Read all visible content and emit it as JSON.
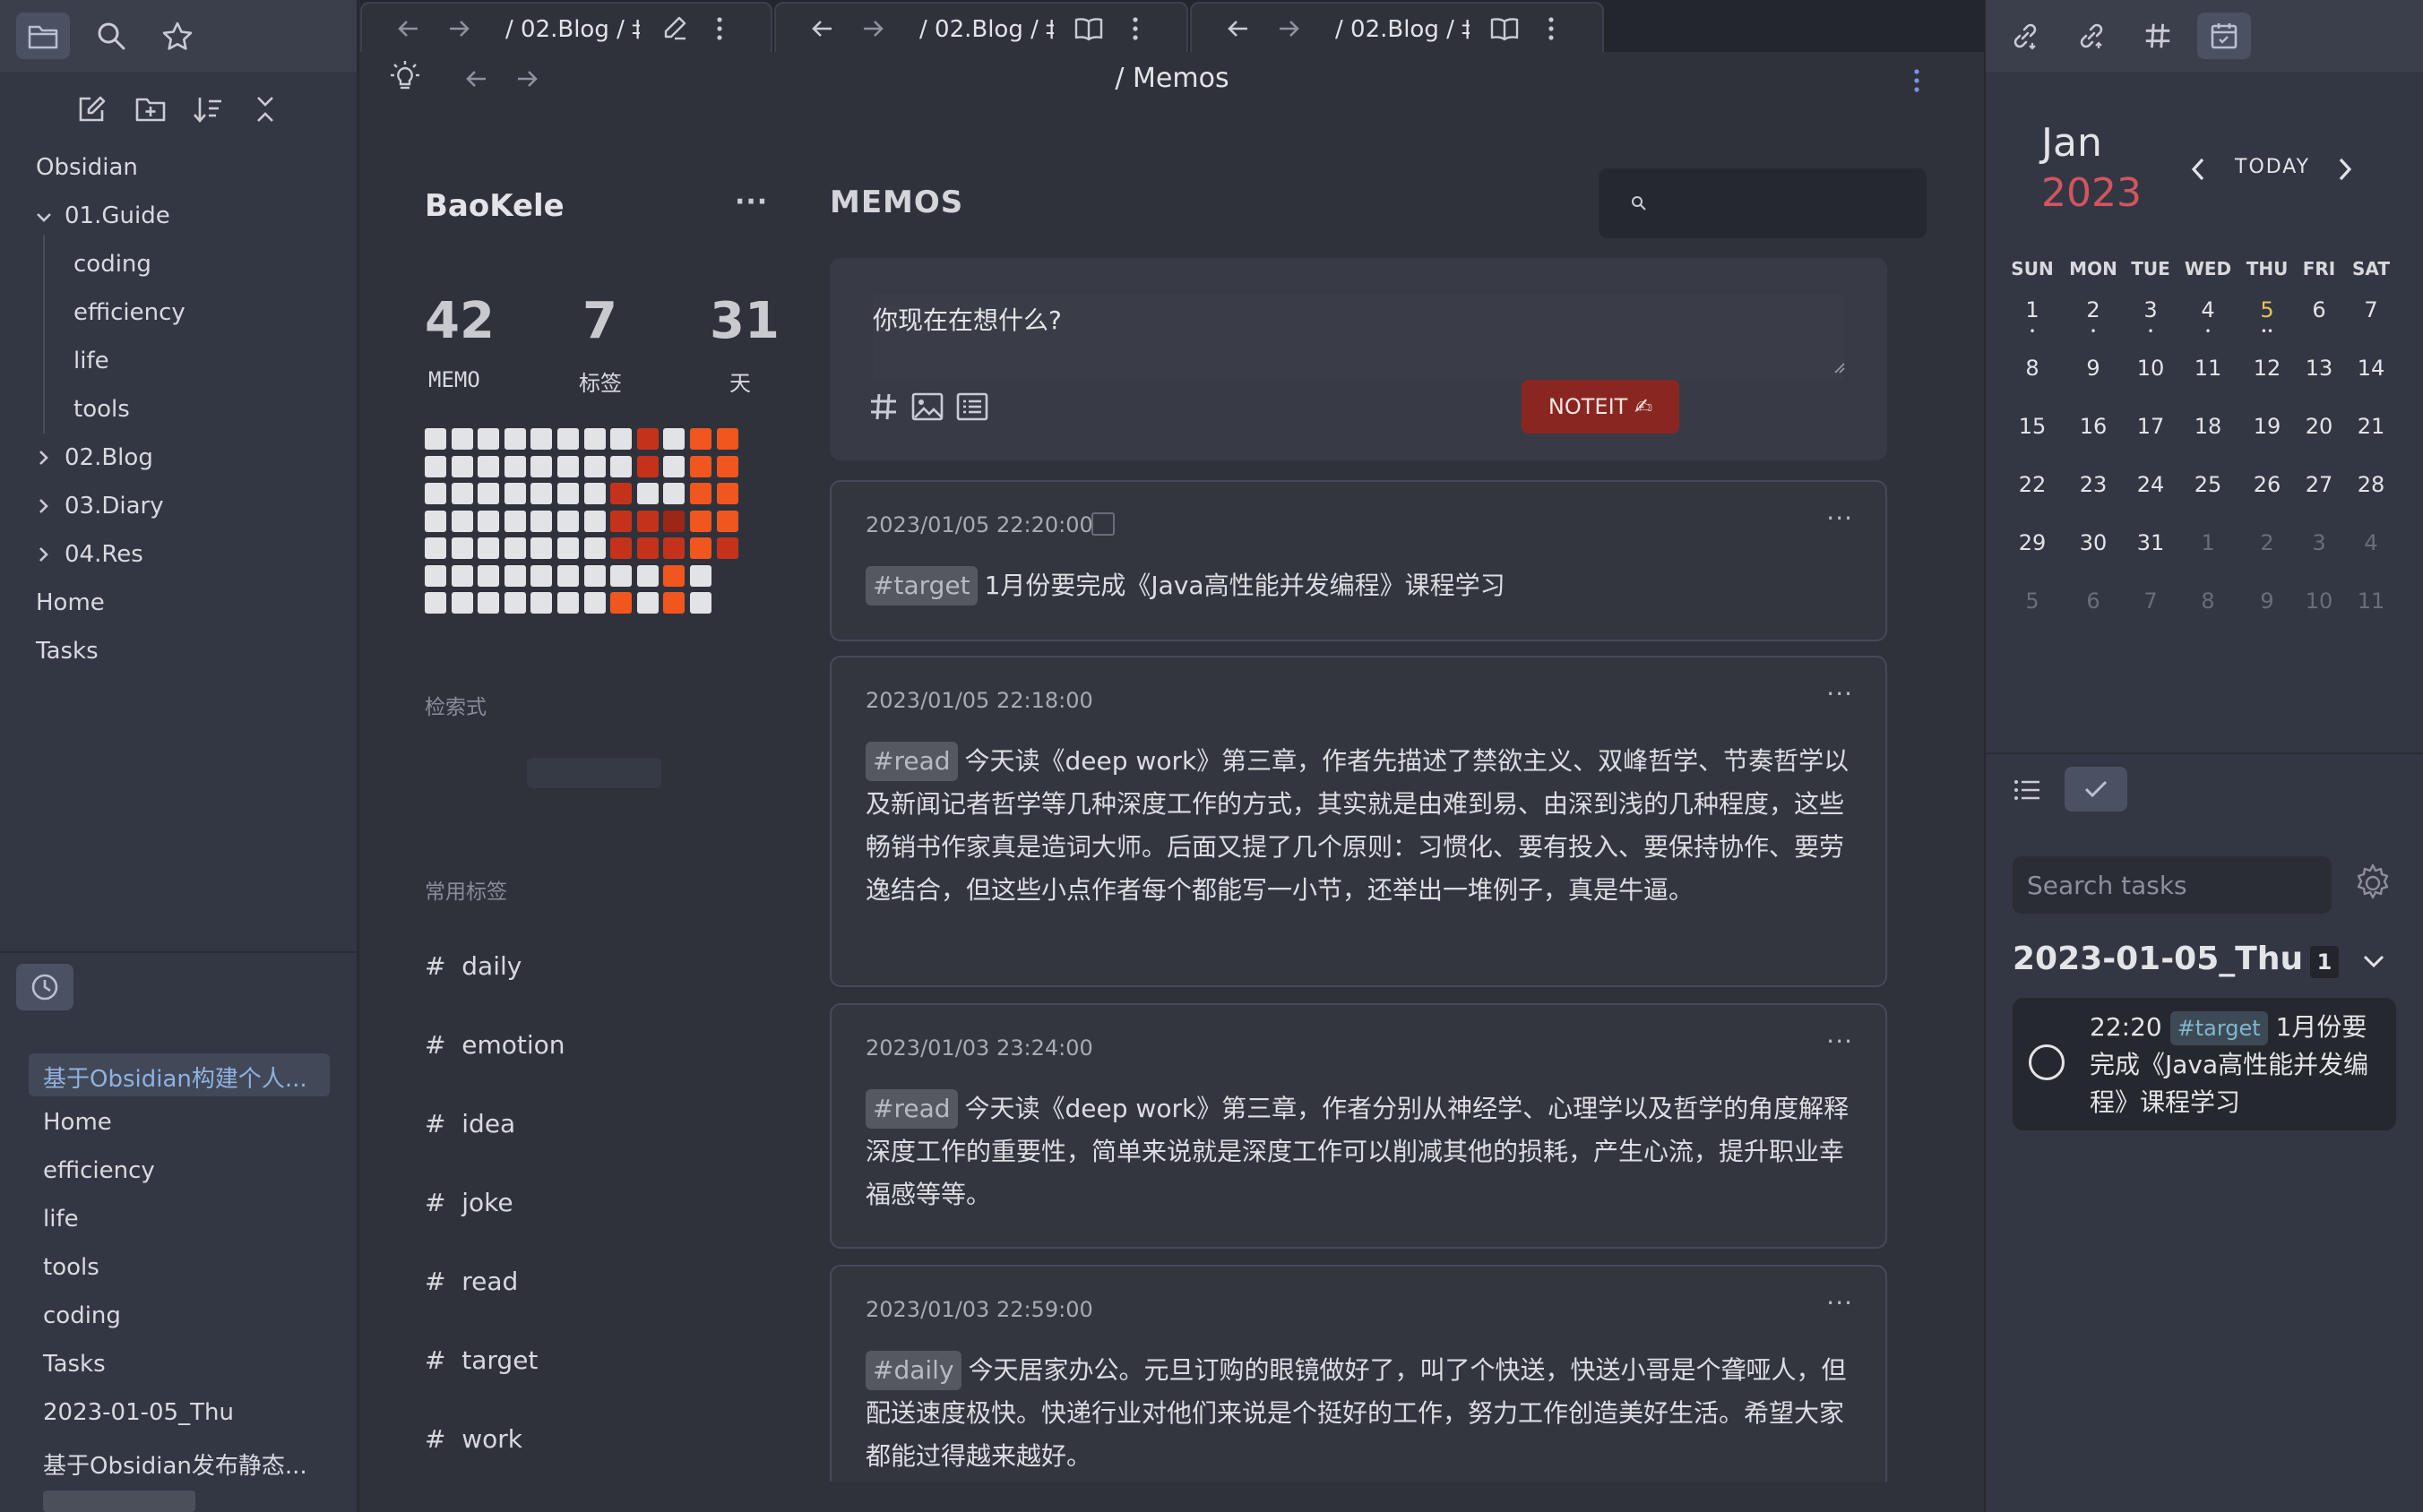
{
  "left_sidebar": {
    "vault_name": "Obsidian",
    "tree": [
      {
        "label": "01.Guide",
        "expanded": true
      },
      {
        "label": "coding"
      },
      {
        "label": "efficiency"
      },
      {
        "label": "life"
      },
      {
        "label": "tools"
      },
      {
        "label": "02.Blog",
        "expanded": false
      },
      {
        "label": "03.Diary",
        "expanded": false
      },
      {
        "label": "04.Res",
        "expanded": false
      },
      {
        "label": "Home"
      },
      {
        "label": "Tasks"
      }
    ],
    "recent": [
      "基于Obsidian构建个人...",
      "Home",
      "efficiency",
      "life",
      "tools",
      "coding",
      "Tasks",
      "2023-01-05_Thu",
      "基于Obsidian发布静态..."
    ]
  },
  "tabs": [
    {
      "crumb": "/ 02.Blog / ‡",
      "mode_icon": "pencil-icon"
    },
    {
      "crumb": "/ 02.Blog / ‡",
      "mode_icon": "book-open-icon"
    },
    {
      "crumb": "/ 02.Blog / ‡",
      "mode_icon": "book-open-icon"
    }
  ],
  "view": {
    "title": "/ Memos"
  },
  "memos": {
    "user_name": "BaoKele",
    "profile_more": "···",
    "stats": [
      {
        "value": "42",
        "label": "MEMO"
      },
      {
        "value": "7",
        "label": "标签"
      },
      {
        "value": "31",
        "label": "天"
      }
    ],
    "heatmap": [
      [
        "e",
        "e",
        "e",
        "e",
        "e",
        "e",
        "e",
        "e",
        "r",
        "e",
        "o",
        "o"
      ],
      [
        "e",
        "e",
        "e",
        "e",
        "e",
        "e",
        "e",
        "e",
        "r",
        "e",
        "o",
        "o"
      ],
      [
        "e",
        "e",
        "e",
        "e",
        "e",
        "e",
        "e",
        "r",
        "e",
        "e",
        "o",
        "o"
      ],
      [
        "e",
        "e",
        "e",
        "e",
        "e",
        "e",
        "e",
        "r",
        "r",
        "d",
        "o",
        "o"
      ],
      [
        "e",
        "e",
        "e",
        "e",
        "e",
        "e",
        "e",
        "r",
        "r",
        "r",
        "o",
        "r"
      ],
      [
        "e",
        "e",
        "e",
        "e",
        "e",
        "e",
        "e",
        "e",
        "e",
        "o",
        "e",
        ""
      ],
      [
        "e",
        "e",
        "e",
        "e",
        "e",
        "e",
        "e",
        "o",
        "e",
        "o",
        "e",
        ""
      ]
    ],
    "query_section_label": "检索式",
    "tags_section_label": "常用标签",
    "tags": [
      "daily",
      "emotion",
      "idea",
      "joke",
      "read",
      "target",
      "work"
    ],
    "title": "MEMOS",
    "editor_placeholder": "你现在在想什么?",
    "submit_label": "NOTEIT ✍",
    "list": [
      {
        "time": "2023/01/05 22:20:00",
        "tag": "#target",
        "text": "1月份要完成《Java高性能并发编程》课程学习"
      },
      {
        "time": "2023/01/05 22:18:00",
        "tag": "#read",
        "text": "今天读《deep work》第三章，作者先描述了禁欲主义、双峰哲学、节奏哲学以及新闻记者哲学等几种深度工作的方式，其实就是由难到易、由深到浅的几种程度，这些畅销书作家真是造词大师。后面又提了几个原则：习惯化、要有投入、要保持协作、要劳逸结合，但这些小点作者每个都能写一小节，还举出一堆例子，真是牛逼。"
      },
      {
        "time": "2023/01/03 23:24:00",
        "tag": "#read",
        "text": "今天读《deep work》第三章，作者分别从神经学、心理学以及哲学的角度解释深度工作的重要性，简单来说就是深度工作可以削减其他的损耗，产生心流，提升职业幸福感等等。"
      },
      {
        "time": "2023/01/03 22:59:00",
        "tag": "#daily",
        "text": "今天居家办公。元旦订购的眼镜做好了，叫了个快送，快送小哥是个聋哑人，但配送速度极快。快递行业对他们来说是个挺好的工作，努力工作创造美好生活。希望大家都能过得越来越好。"
      }
    ]
  },
  "calendar": {
    "month": "Jan",
    "year": "2023",
    "today_label": "TODAY",
    "weekdays": [
      "SUN",
      "MON",
      "TUE",
      "WED",
      "THU",
      "FRI",
      "SAT"
    ],
    "weeks": [
      [
        "1",
        "2",
        "3",
        "4",
        "5",
        "6",
        "7"
      ],
      [
        "8",
        "9",
        "10",
        "11",
        "12",
        "13",
        "14"
      ],
      [
        "15",
        "16",
        "17",
        "18",
        "19",
        "20",
        "21"
      ],
      [
        "22",
        "23",
        "24",
        "25",
        "26",
        "27",
        "28"
      ],
      [
        "29",
        "30",
        "31",
        "1",
        "2",
        "3",
        "4"
      ],
      [
        "5",
        "6",
        "7",
        "8",
        "9",
        "10",
        "11"
      ]
    ],
    "today": "5",
    "accent_year_color": "#d2555f",
    "today_color": "#e8c15a"
  },
  "tasks": {
    "search_placeholder": "Search tasks",
    "date_title": "2023-01-05_Thu",
    "count": "1",
    "item": {
      "time": "22:20",
      "tag": "#target",
      "text": "1月份要完成《Java高性能并发编程》课程学习"
    }
  },
  "colors": {
    "heat_empty": "#e2e3e6",
    "heat_orange": "#f0561e",
    "heat_red": "#c5321b",
    "heat_dark": "#9c2716",
    "accent_button": "#8a2622"
  }
}
